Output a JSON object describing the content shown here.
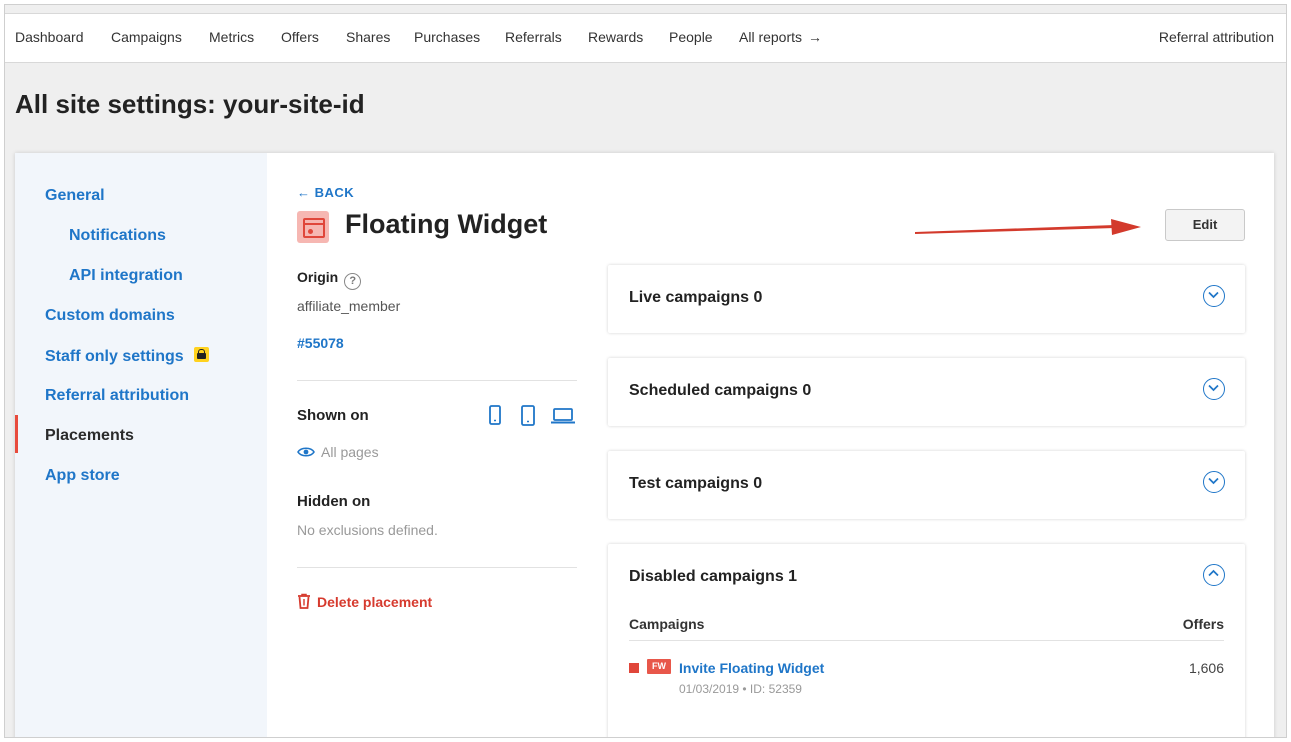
{
  "nav": {
    "items": [
      "Dashboard",
      "Campaigns",
      "Metrics",
      "Offers",
      "Shares",
      "Purchases",
      "Referrals",
      "Rewards",
      "People",
      "All reports"
    ],
    "right_link": "Referral attribution"
  },
  "page": {
    "title": "All site settings: your-site-id"
  },
  "sidebar": {
    "items": [
      "General",
      "Notifications",
      "API integration",
      "Custom domains",
      "Staff only settings",
      "Referral attribution",
      "Placements",
      "App store"
    ],
    "active": "Placements"
  },
  "detail": {
    "back": "BACK",
    "title": "Floating Widget",
    "edit": "Edit",
    "origin_label": "Origin",
    "origin_help": "?",
    "origin_value": "affiliate_member",
    "id_link": "#55078",
    "shown_on_label": "Shown on",
    "shown_on_value": "All pages",
    "hidden_on_label": "Hidden on",
    "hidden_on_value": "No exclusions defined.",
    "delete": "Delete placement"
  },
  "panels": [
    {
      "title": "Live campaigns 0",
      "expanded": false
    },
    {
      "title": "Scheduled campaigns 0",
      "expanded": false
    },
    {
      "title": "Test campaigns 0",
      "expanded": false
    },
    {
      "title": "Disabled campaigns 1",
      "expanded": true
    }
  ],
  "disabled_table": {
    "col_campaigns": "Campaigns",
    "col_offers": "Offers",
    "rows": [
      {
        "badge": "FW",
        "name": "Invite Floating Widget",
        "meta": "01/03/2019 • ID: 52359",
        "offers": "1,606"
      }
    ]
  },
  "colors": {
    "link": "#1f76c8",
    "accent_red": "#e0463a",
    "sidebar_bg": "#f2f6fb"
  }
}
